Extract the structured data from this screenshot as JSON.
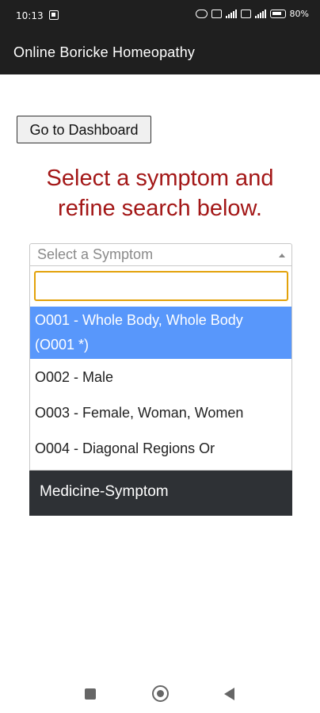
{
  "status_bar": {
    "time": "10:13",
    "battery": "80",
    "icons": [
      "linkedin-icon",
      "link-icon",
      "vo-icon",
      "signal-icon",
      "vo-icon",
      "signal-icon",
      "battery-icon"
    ]
  },
  "app_bar": {
    "title": "Online Boricke Homeopathy"
  },
  "dashboard_button": {
    "label": "Go to Dashboard"
  },
  "headline": {
    "line1": "Select a symptom and",
    "line2": "refine search below."
  },
  "symptom_select": {
    "placeholder": "Select a Symptom",
    "search_value": "",
    "options": [
      {
        "line1": "O001 - Whole Body, Whole Body",
        "line2": "(O001 *)"
      },
      {
        "label": "O002 - Male"
      },
      {
        "label": "O003 - Female, Woman, Women"
      },
      {
        "label": "O004 - Diagonal Regions Or"
      }
    ]
  },
  "medicine_section": {
    "label": "Medicine-Symptom"
  },
  "colors": {
    "app_bar": "#1f1f1f",
    "headline": "#a31717",
    "highlight": "#5897fb",
    "search_focus_border": "#e3a20a",
    "medicine_bar": "#2e3135"
  },
  "nav_icons": [
    "recents-square-icon",
    "home-circle-icon",
    "back-triangle-icon"
  ]
}
